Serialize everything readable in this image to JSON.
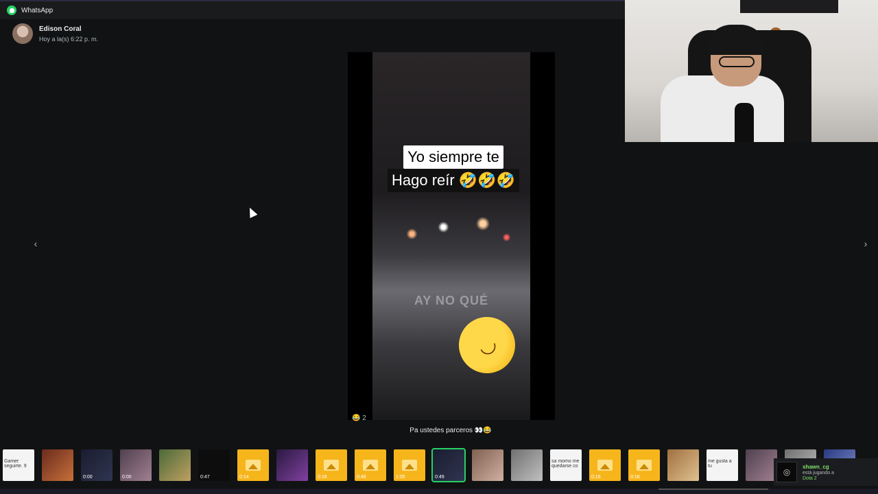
{
  "app": {
    "title": "WhatsApp",
    "accent": "#25d366"
  },
  "sender": {
    "name": "Edison Coral",
    "time": "Hoy a la(s) 6:22 p. m."
  },
  "viewer": {
    "prev_icon": "chevron-left-icon",
    "next_icon": "chevron-right-icon",
    "video_caption_line1": "Yo siempre te",
    "video_caption_line2": "Hago reír 🤣🤣🤣",
    "overlay_text": "AY NO QUÉ",
    "big_emoji": "🤣",
    "reaction": "😂 2",
    "message_caption": "Pa ustedes parceros 👀😂"
  },
  "thumbnails": [
    {
      "kind": "white",
      "text": "Gamer seguirte. 9",
      "duration": ""
    },
    {
      "kind": "photo-red",
      "text": "",
      "duration": ""
    },
    {
      "kind": "photo-navy",
      "text": "",
      "duration": "0:00"
    },
    {
      "kind": "photo",
      "text": "",
      "duration": "0:00"
    },
    {
      "kind": "photo-green",
      "text": "",
      "duration": ""
    },
    {
      "kind": "dark",
      "text": "",
      "duration": "0:47"
    },
    {
      "kind": "yellow",
      "text": "",
      "duration": "0:14"
    },
    {
      "kind": "photo-purple",
      "text": "",
      "duration": ""
    },
    {
      "kind": "yellow",
      "text": "",
      "duration": "0:16"
    },
    {
      "kind": "yellow",
      "text": "",
      "duration": "0:46"
    },
    {
      "kind": "yellow",
      "text": "",
      "duration": "1:05"
    },
    {
      "kind": "selected",
      "text": "",
      "duration": "0:49"
    },
    {
      "kind": "photo-face",
      "text": "",
      "duration": ""
    },
    {
      "kind": "photo-mix",
      "text": "",
      "duration": ""
    },
    {
      "kind": "white",
      "text": "sa momo me quedarse co",
      "duration": ""
    },
    {
      "kind": "yellow",
      "text": "",
      "duration": "0:16"
    },
    {
      "kind": "yellow",
      "text": "",
      "duration": "0:16"
    },
    {
      "kind": "photo-dog",
      "text": "",
      "duration": ""
    },
    {
      "kind": "white",
      "text": "me gusta a tu",
      "duration": ""
    },
    {
      "kind": "photo",
      "text": "",
      "duration": ""
    },
    {
      "kind": "photo-mix",
      "text": "",
      "duration": ""
    },
    {
      "kind": "photo-blue",
      "text": "",
      "duration": ""
    }
  ],
  "notification": {
    "user": "shawn_cg",
    "status": "está jugando a",
    "game": "Dota 2"
  }
}
